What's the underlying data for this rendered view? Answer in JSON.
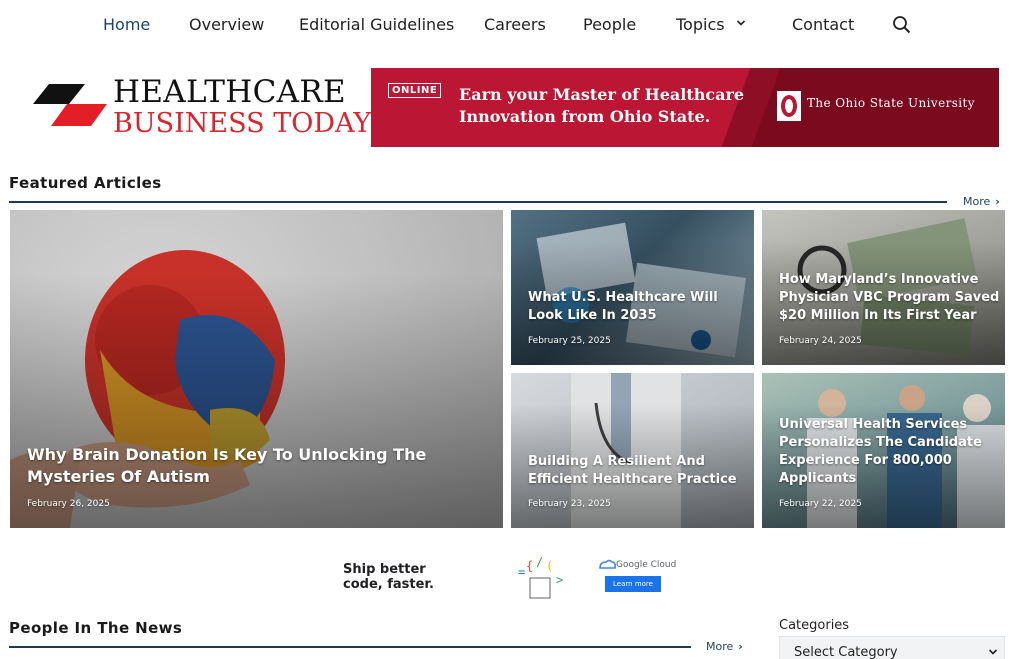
{
  "nav": {
    "items": [
      {
        "label": "Home",
        "active": true
      },
      {
        "label": "Overview"
      },
      {
        "label": "Editorial Guidelines"
      },
      {
        "label": "Careers"
      },
      {
        "label": "People"
      },
      {
        "label": "Topics",
        "has_dropdown": true
      },
      {
        "label": "Contact"
      }
    ],
    "search_icon": "search-icon"
  },
  "logo": {
    "line1": "HEALTHCARE",
    "line2": "BUSINESS TODAY"
  },
  "banner": {
    "badge": "ONLINE",
    "headline": "Earn your Master of Healthcare Innovation from Ohio State.",
    "university": "The Ohio State University",
    "colors": {
      "background": "#bb1633",
      "dark": "#8e0e25"
    }
  },
  "featured": {
    "title": "Featured Articles",
    "more_label": "More",
    "articles": [
      {
        "title": "Why Brain Donation Is Key To Unlocking The Mysteries Of Autism",
        "date": "February 26, 2025"
      },
      {
        "title": "What U.S. Healthcare Will Look Like In 2035",
        "date": "February 25, 2025"
      },
      {
        "title": "How Maryland’s Innovative Physician VBC Program Saved $20 Million In Its First Year",
        "date": "February 24, 2025"
      },
      {
        "title": "Building A Resilient And Efficient Healthcare Practice",
        "date": "February 23, 2025"
      },
      {
        "title": "Universal Health Services Personalizes The Candidate Experience For 800,000 Applicants",
        "date": "February 22, 2025"
      }
    ]
  },
  "google_ad": {
    "line1": "Ship better",
    "line2": "code, faster.",
    "brand": "Google Cloud",
    "button": "Learn more"
  },
  "people": {
    "title": "People In The News",
    "more_label": "More"
  },
  "sidebar": {
    "categories_label": "Categories",
    "select_value": "Select Category"
  },
  "colors": {
    "accent": "#1d4466",
    "rule": "#1d3a5c",
    "logo_red": "#d7262d"
  }
}
